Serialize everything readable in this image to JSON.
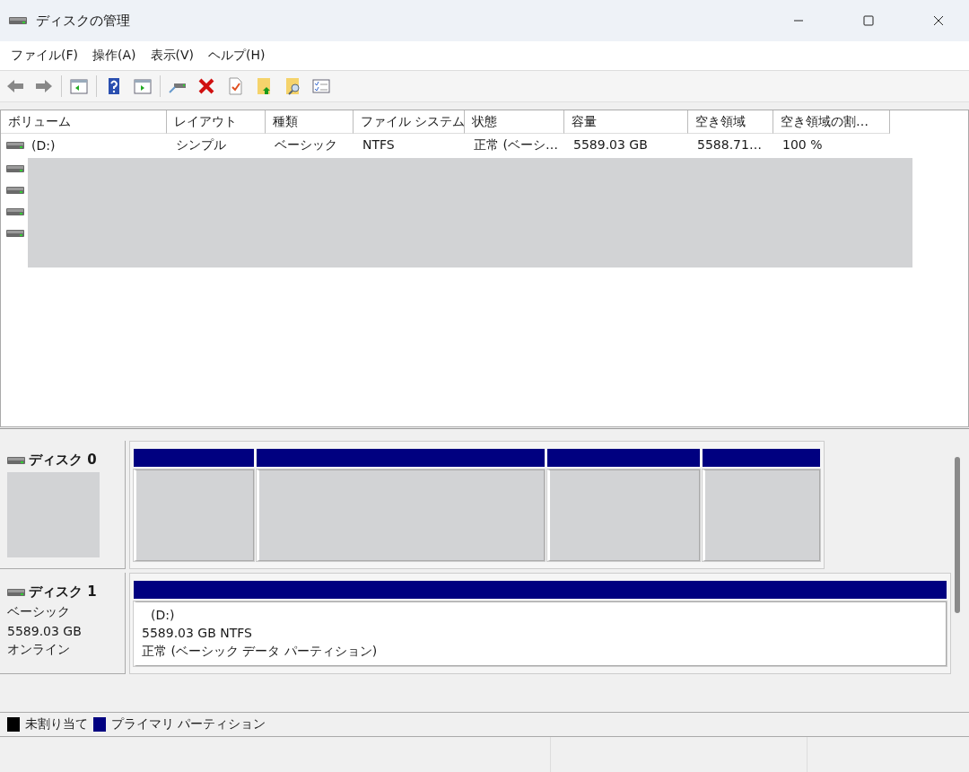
{
  "window": {
    "title": "ディスクの管理"
  },
  "menu": [
    "ファイル(F)",
    "操作(A)",
    "表示(V)",
    "ヘルプ(H)"
  ],
  "volume_table": {
    "columns": [
      "ボリューム",
      "レイアウト",
      "種類",
      "ファイル システム",
      "状態",
      "容量",
      "空き領域",
      "空き領域の割…"
    ],
    "rows": [
      [
        "(D:)",
        "シンプル",
        "ベーシック",
        "NTFS",
        "正常 (ベーシ…",
        "5589.03 GB",
        "5588.71…",
        "100 %"
      ]
    ]
  },
  "disks": [
    {
      "name": "ディスク 0",
      "partitions": [
        {
          "color": "#000080"
        },
        {
          "color": "#000080"
        },
        {
          "color": "#000080"
        },
        {
          "color": "#000080"
        }
      ]
    },
    {
      "name": "ディスク 1",
      "details": [
        "ベーシック",
        "5589.03 GB",
        "オンライン"
      ],
      "partitions": [
        {
          "color": "#000080",
          "label": "(D:)",
          "size": "5589.03 GB NTFS",
          "status": "正常 (ベーシック データ パーティション)"
        }
      ]
    }
  ],
  "legend": [
    {
      "label": "未割り当て",
      "color": "#000000"
    },
    {
      "label": "プライマリ パーティション",
      "color": "#000080"
    }
  ]
}
